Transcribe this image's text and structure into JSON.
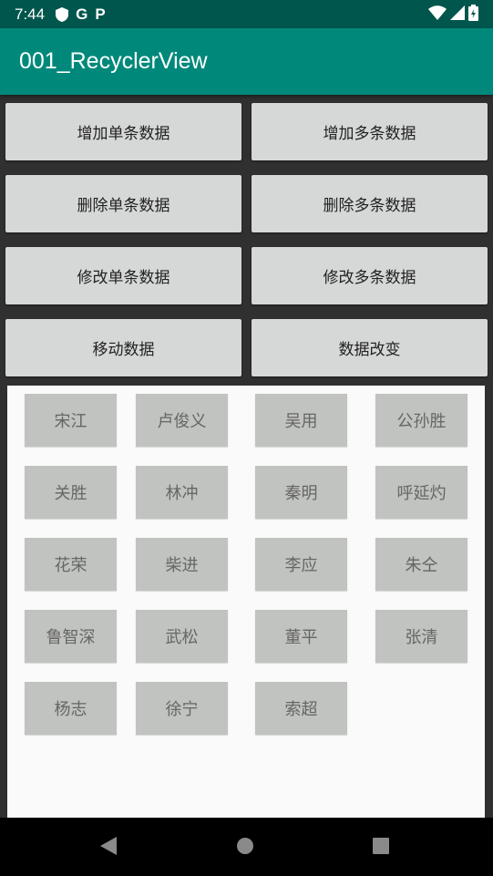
{
  "status_bar": {
    "time": "7:44",
    "left_icons": [
      "shield-icon",
      "google-icon",
      "parking-icon"
    ],
    "right_icons": [
      "wifi-icon",
      "signal-icon",
      "battery-icon"
    ]
  },
  "app_bar": {
    "title": "001_RecyclerView"
  },
  "buttons": [
    {
      "label": "增加单条数据"
    },
    {
      "label": "增加多条数据"
    },
    {
      "label": "删除单条数据"
    },
    {
      "label": "删除多条数据"
    },
    {
      "label": "修改单条数据"
    },
    {
      "label": "修改多条数据"
    },
    {
      "label": "移动数据"
    },
    {
      "label": "数据改变"
    }
  ],
  "grid_items": [
    "宋江",
    "卢俊义",
    "吴用",
    "公孙胜",
    "关胜",
    "林冲",
    "秦明",
    "呼延灼",
    "花荣",
    "柴进",
    "李应",
    "朱仝",
    "鲁智深",
    "武松",
    "董平",
    "张清",
    "杨志",
    "徐宁",
    "索超"
  ],
  "nav_bar": {
    "icons": [
      "back-icon",
      "home-icon",
      "recents-icon"
    ]
  },
  "colors": {
    "status_bar": "#00564d",
    "app_bar": "#00897b",
    "button_bg": "#d6d7d7",
    "chip_bg": "#c0c3bf",
    "panel_bg": "#fafafa",
    "screen_bg": "#303030"
  }
}
